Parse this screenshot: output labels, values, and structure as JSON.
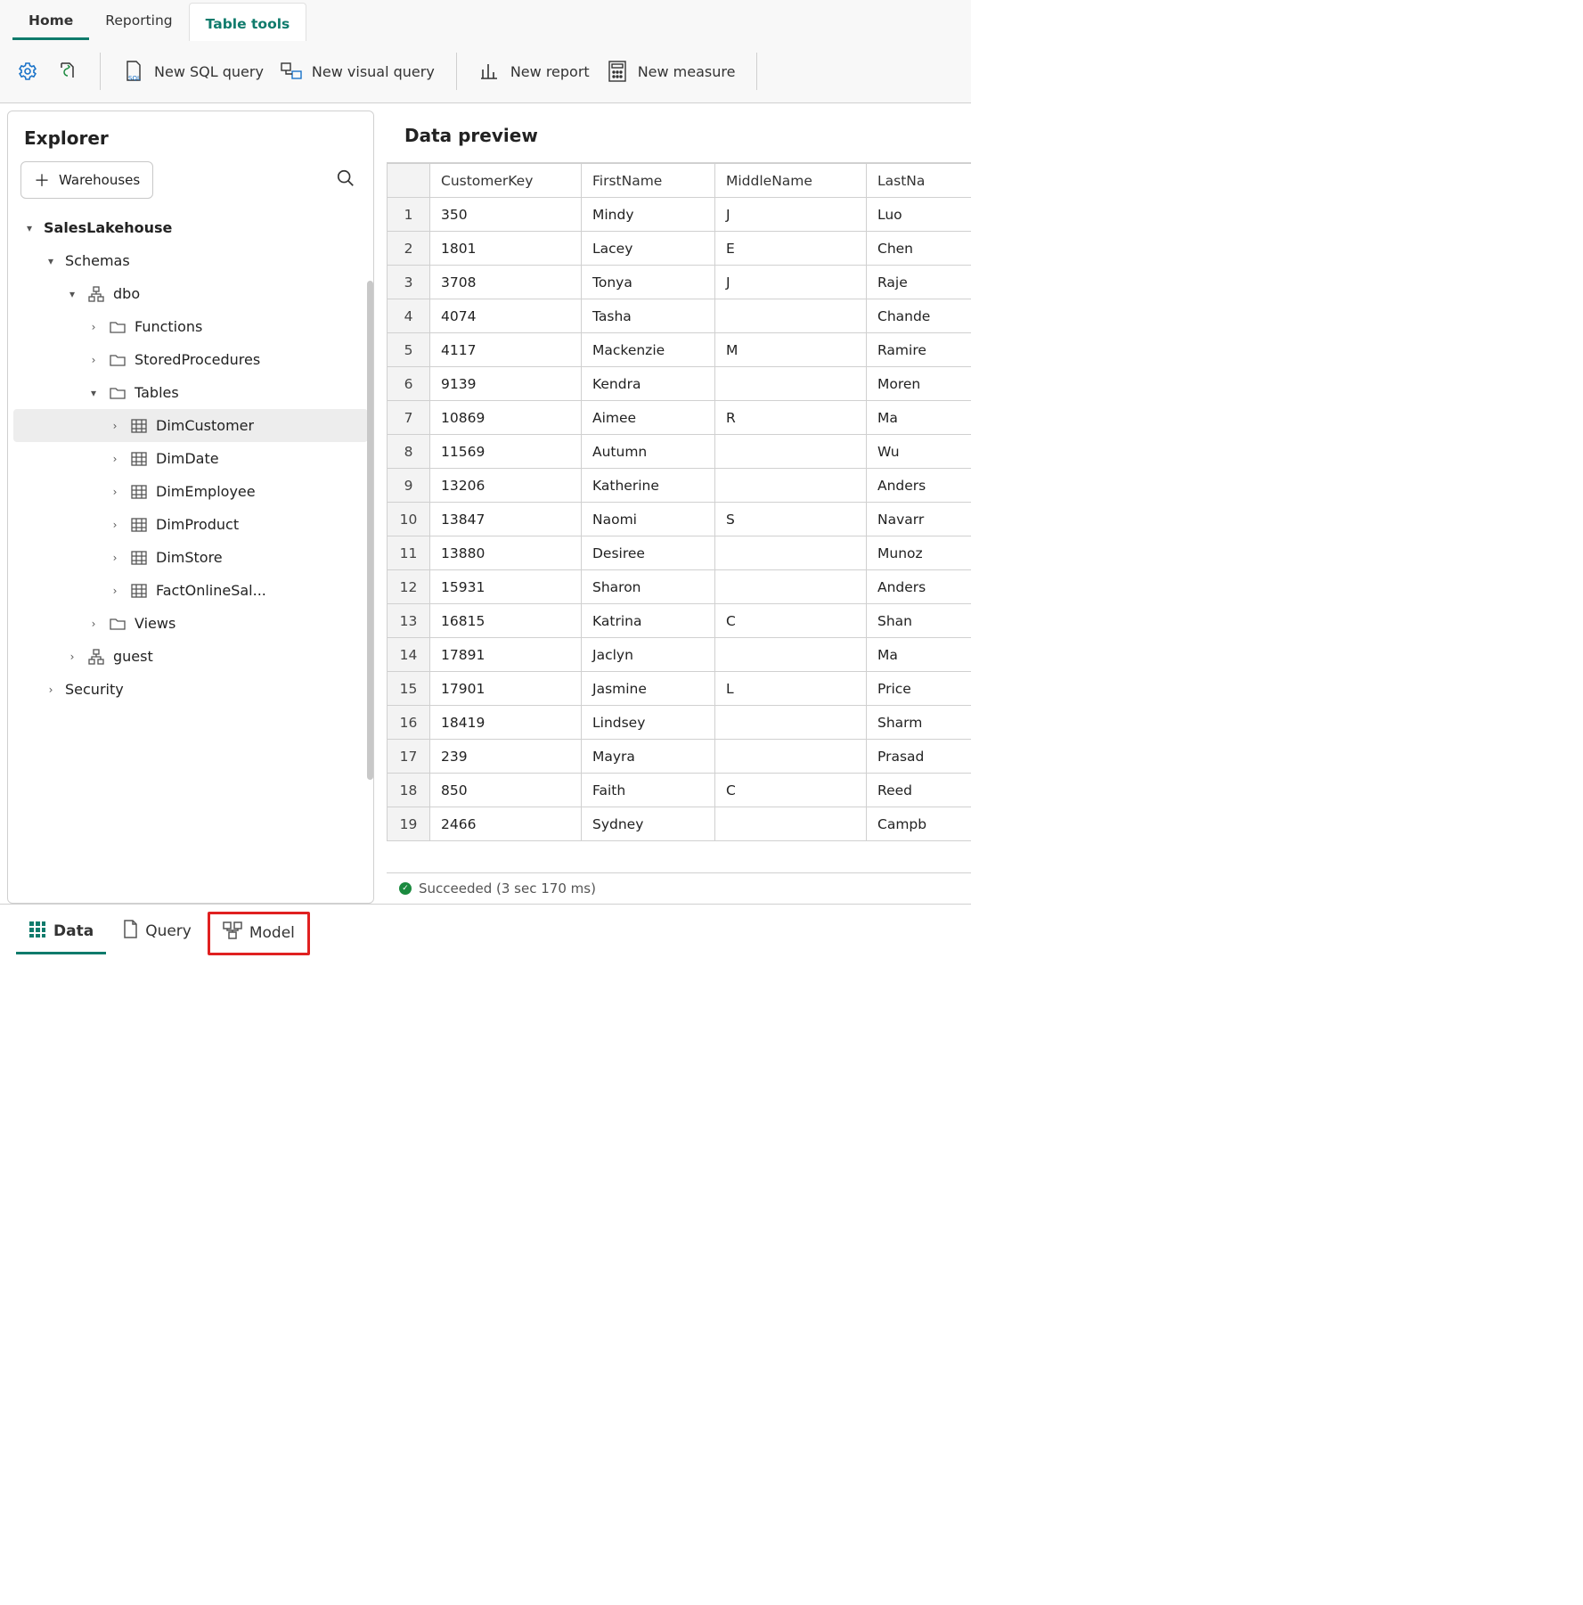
{
  "ribbon": {
    "tabs": [
      "Home",
      "Reporting",
      "Table tools"
    ]
  },
  "toolbar": {
    "new_sql_query": "New SQL query",
    "new_visual_query": "New visual query",
    "new_report": "New report",
    "new_measure": "New measure"
  },
  "explorer": {
    "title": "Explorer",
    "warehouses_btn": "Warehouses",
    "tree": {
      "root": "SalesLakehouse",
      "schemas_label": "Schemas",
      "dbo_label": "dbo",
      "functions_label": "Functions",
      "sprocs_label": "StoredProcedures",
      "tables_label": "Tables",
      "tables": [
        "DimCustomer",
        "DimDate",
        "DimEmployee",
        "DimProduct",
        "DimStore",
        "FactOnlineSal..."
      ],
      "views_label": "Views",
      "guest_label": "guest",
      "security_label": "Security"
    }
  },
  "preview": {
    "title": "Data preview",
    "columns": [
      "CustomerKey",
      "FirstName",
      "MiddleName",
      "LastNa"
    ],
    "rows": [
      [
        "350",
        "Mindy",
        "J",
        "Luo"
      ],
      [
        "1801",
        "Lacey",
        "E",
        "Chen"
      ],
      [
        "3708",
        "Tonya",
        "J",
        "Raje"
      ],
      [
        "4074",
        "Tasha",
        "",
        "Chande"
      ],
      [
        "4117",
        "Mackenzie",
        "M",
        "Ramire"
      ],
      [
        "9139",
        "Kendra",
        "",
        "Moren"
      ],
      [
        "10869",
        "Aimee",
        "R",
        "Ma"
      ],
      [
        "11569",
        "Autumn",
        "",
        "Wu"
      ],
      [
        "13206",
        "Katherine",
        "",
        "Anders"
      ],
      [
        "13847",
        "Naomi",
        "S",
        "Navarr"
      ],
      [
        "13880",
        "Desiree",
        "",
        "Munoz"
      ],
      [
        "15931",
        "Sharon",
        "",
        "Anders"
      ],
      [
        "16815",
        "Katrina",
        "C",
        "Shan"
      ],
      [
        "17891",
        "Jaclyn",
        "",
        "Ma"
      ],
      [
        "17901",
        "Jasmine",
        "L",
        "Price"
      ],
      [
        "18419",
        "Lindsey",
        "",
        "Sharm"
      ],
      [
        "239",
        "Mayra",
        "",
        "Prasad"
      ],
      [
        "850",
        "Faith",
        "C",
        "Reed"
      ],
      [
        "2466",
        "Sydney",
        "",
        "Campb"
      ]
    ],
    "status": "Succeeded (3 sec 170 ms)"
  },
  "bottom": {
    "data": "Data",
    "query": "Query",
    "model": "Model"
  }
}
